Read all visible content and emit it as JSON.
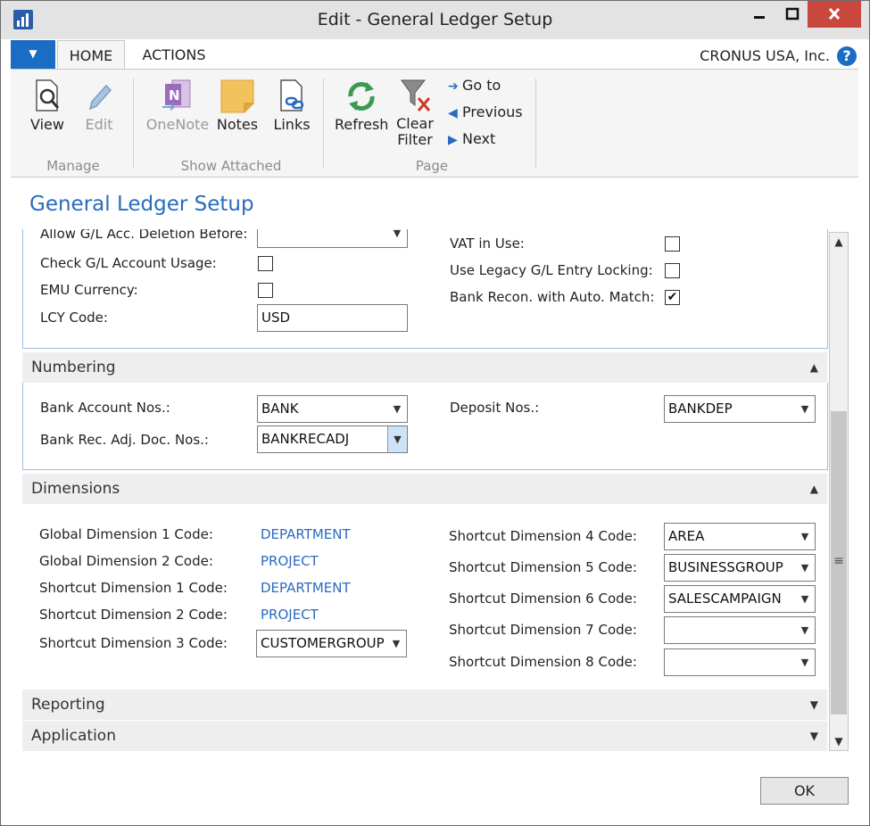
{
  "window": {
    "title": "Edit - General Ledger Setup"
  },
  "ribbon_tabs": {
    "home": "HOME",
    "actions": "ACTIONS"
  },
  "company": "CRONUS USA, Inc.",
  "ribbon": {
    "manage": {
      "label": "Manage",
      "view": "View",
      "edit": "Edit"
    },
    "show_attached": {
      "label": "Show Attached",
      "onenote": "OneNote",
      "notes": "Notes",
      "links": "Links"
    },
    "page": {
      "label": "Page",
      "refresh": "Refresh",
      "clear_filter": "Clear\nFilter",
      "goto": "Go to",
      "previous": "Previous",
      "next": "Next"
    }
  },
  "page_title": "General Ledger Setup",
  "general": {
    "allow_deletion_label": "Allow G/L Acc. Deletion Before:",
    "allow_deletion_value": "",
    "check_usage_label": "Check G/L Account Usage:",
    "check_usage_checked": false,
    "emu_currency_label": "EMU Currency:",
    "emu_currency_checked": false,
    "lcy_code_label": "LCY Code:",
    "lcy_code_value": "USD",
    "vat_in_use_label": "VAT in Use:",
    "vat_in_use_checked": false,
    "legacy_locking_label": "Use Legacy G/L Entry Locking:",
    "legacy_locking_checked": false,
    "bank_recon_label": "Bank Recon. with Auto. Match:",
    "bank_recon_checked": true,
    "check_mark": "✔"
  },
  "numbering": {
    "header": "Numbering",
    "bank_account_nos_label": "Bank Account Nos.:",
    "bank_account_nos_value": "BANK",
    "bank_rec_adj_label": "Bank Rec. Adj. Doc. Nos.:",
    "bank_rec_adj_value": "BANKRECADJ",
    "deposit_nos_label": "Deposit Nos.:",
    "deposit_nos_value": "BANKDEP"
  },
  "dimensions": {
    "header": "Dimensions",
    "global1_label": "Global Dimension 1 Code:",
    "global1_value": "DEPARTMENT",
    "global2_label": "Global Dimension 2 Code:",
    "global2_value": "PROJECT",
    "shortcut1_label": "Shortcut Dimension 1 Code:",
    "shortcut1_value": "DEPARTMENT",
    "shortcut2_label": "Shortcut Dimension 2 Code:",
    "shortcut2_value": "PROJECT",
    "shortcut3_label": "Shortcut Dimension 3 Code:",
    "shortcut3_value": "CUSTOMERGROUP",
    "shortcut4_label": "Shortcut Dimension 4 Code:",
    "shortcut4_value": "AREA",
    "shortcut5_label": "Shortcut Dimension 5 Code:",
    "shortcut5_value": "BUSINESSGROUP",
    "shortcut6_label": "Shortcut Dimension 6 Code:",
    "shortcut6_value": "SALESCAMPAIGN",
    "shortcut7_label": "Shortcut Dimension 7 Code:",
    "shortcut7_value": "",
    "shortcut8_label": "Shortcut Dimension 8 Code:",
    "shortcut8_value": ""
  },
  "reporting": {
    "header": "Reporting"
  },
  "application": {
    "header": "Application"
  },
  "ok_button": "OK"
}
